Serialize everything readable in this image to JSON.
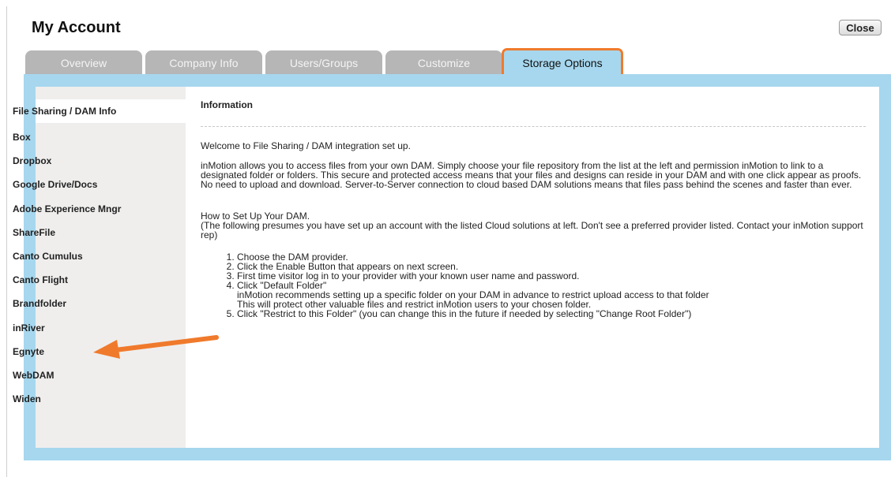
{
  "window": {
    "title": "My Account",
    "close_label": "Close"
  },
  "tabs": [
    {
      "label": "Overview",
      "active": false
    },
    {
      "label": "Company Info",
      "active": false
    },
    {
      "label": "Users/Groups",
      "active": false
    },
    {
      "label": "Customize",
      "active": false
    },
    {
      "label": "Storage Options",
      "active": true
    }
  ],
  "sidebar": {
    "items": [
      {
        "label": "File Sharing / DAM Info",
        "selected": true
      },
      {
        "label": "Box"
      },
      {
        "label": "Dropbox"
      },
      {
        "label": "Google Drive/Docs"
      },
      {
        "label": "Adobe Experience Mngr"
      },
      {
        "label": "ShareFile"
      },
      {
        "label": "Canto Cumulus"
      },
      {
        "label": "Canto Flight"
      },
      {
        "label": "Brandfolder"
      },
      {
        "label": "inRiver"
      },
      {
        "label": "Egnyte"
      },
      {
        "label": "WebDAM"
      },
      {
        "label": "Widen"
      }
    ]
  },
  "content": {
    "heading": "Information",
    "welcome": "Welcome to File Sharing / DAM integration set up.",
    "intro": "inMotion allows you to access files from your own DAM. Simply choose your file repository from the list at the left and permission inMotion to link to a designated folder or folders. This secure and protected access means that your files and designs can reside in your DAM and with one click appear as proofs. No need to upload and download. Server-to-Server connection to cloud based DAM solutions means that files pass behind the scenes and faster than ever.",
    "setup_title": "How to Set Up Your DAM.",
    "setup_note": "(The following presumes you have set up an account with the listed Cloud solutions at left. Don't see a preferred provider listed. Contact your inMotion support rep)",
    "steps": [
      "Choose the DAM provider.",
      "Click the Enable Button that appears on next screen.",
      "First time visitor log in to your provider with your known user name and password.",
      "Click \"Default Folder\"",
      "Click \"Restrict to this Folder\" (you can change this in the future if needed by selecting \"Change Root Folder\")"
    ],
    "step4_detail_1": "inMotion recommends setting up a specific folder on your DAM in advance to restrict upload access to that folder",
    "step4_detail_2": "This will protect other valuable files and restrict inMotion users to your chosen folder."
  },
  "colors": {
    "frame": "#a6d7ee",
    "tab_inactive": "#b6b6b6",
    "highlight": "#f07a2c",
    "sidebar": "#efeeed"
  },
  "annotation": {
    "icon": "arrow-left-icon",
    "target": "Egnyte"
  }
}
